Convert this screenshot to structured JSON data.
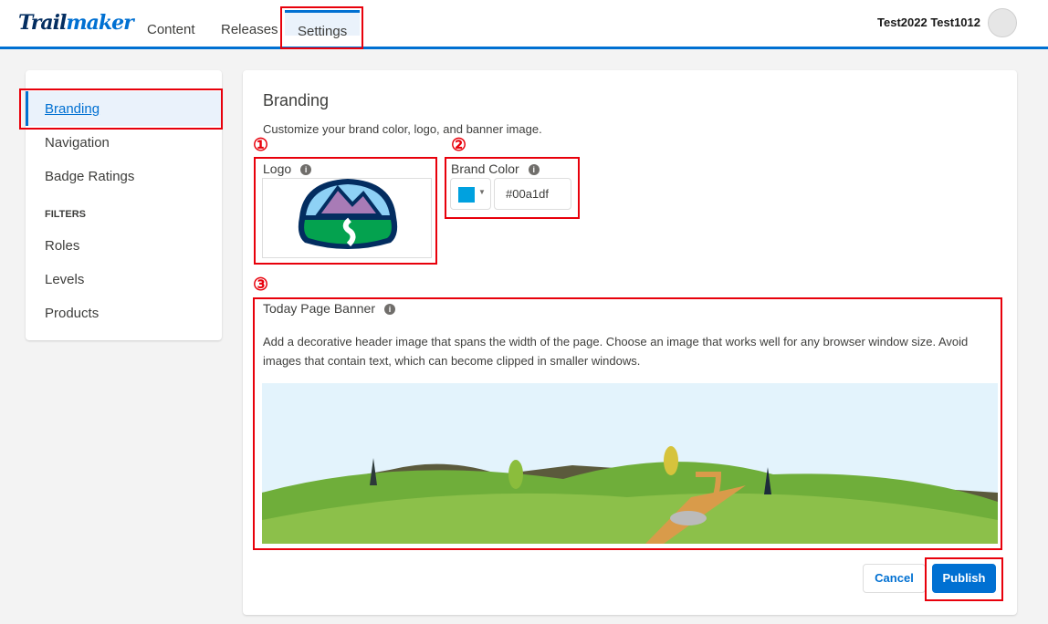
{
  "header": {
    "logo_a": "Trail",
    "logo_b": "maker",
    "tabs": [
      {
        "label": "Content"
      },
      {
        "label": "Releases"
      },
      {
        "label": "Settings",
        "active": true
      }
    ],
    "user": "Test2022 Test1012"
  },
  "sidebar": {
    "items": [
      {
        "label": "Branding",
        "active": true
      },
      {
        "label": "Navigation"
      },
      {
        "label": "Badge Ratings"
      }
    ],
    "filters_heading": "FILTERS",
    "filters": [
      {
        "label": "Roles"
      },
      {
        "label": "Levels"
      },
      {
        "label": "Products"
      }
    ]
  },
  "main": {
    "title": "Branding",
    "subtitle": "Customize your brand color, logo, and banner image.",
    "logo_label": "Logo",
    "brand_color_label": "Brand Color",
    "brand_color_value": "#00a1df",
    "banner_label": "Today Page Banner",
    "banner_desc": "Add a decorative header image that spans the width of the page. Choose an image that works well for any browser window size. Avoid images that contain text, which can become clipped in smaller windows.",
    "cancel": "Cancel",
    "publish": "Publish"
  },
  "annotations": {
    "n1": "①",
    "n2": "②",
    "n3": "③"
  },
  "colors": {
    "accent": "#0070d2",
    "brand": "#00a1df",
    "highlight": "#e8000b"
  }
}
